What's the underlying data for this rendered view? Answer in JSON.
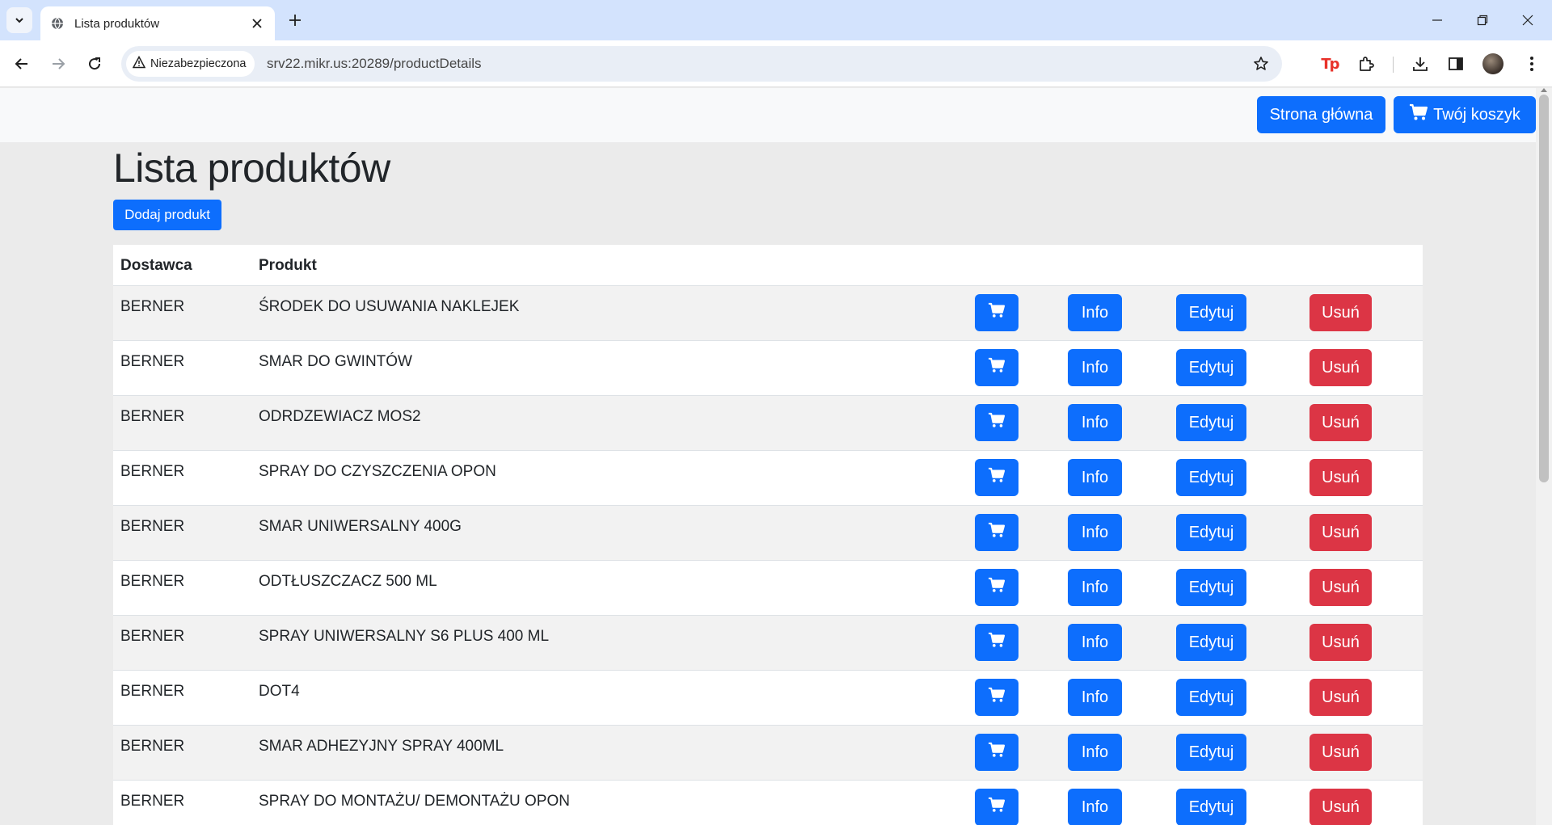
{
  "browser": {
    "tab_title": "Lista produktów",
    "security_label": "Niezabezpieczona",
    "url": "srv22.mikr.us:20289/productDetails"
  },
  "navbar": {
    "home_label": "Strona główna",
    "cart_label": "Twój koszyk"
  },
  "page": {
    "title": "Lista produktów",
    "add_button": "Dodaj produkt"
  },
  "table": {
    "headers": {
      "supplier": "Dostawca",
      "product": "Produkt"
    },
    "info_label": "Info",
    "edit_label": "Edytuj",
    "delete_label": "Usuń",
    "rows": [
      {
        "supplier": "BERNER",
        "product": "ŚRODEK DO USUWANIA NAKLEJEK"
      },
      {
        "supplier": "BERNER",
        "product": "SMAR DO GWINTÓW"
      },
      {
        "supplier": "BERNER",
        "product": "ODRDZEWIACZ MOS2"
      },
      {
        "supplier": "BERNER",
        "product": "SPRAY DO CZYSZCZENIA OPON"
      },
      {
        "supplier": "BERNER",
        "product": "SMAR UNIWERSALNY 400G"
      },
      {
        "supplier": "BERNER",
        "product": "ODTŁUSZCZACZ 500 ML"
      },
      {
        "supplier": "BERNER",
        "product": "SPRAY UNIWERSALNY S6 PLUS 400 ML"
      },
      {
        "supplier": "BERNER",
        "product": "DOT4"
      },
      {
        "supplier": "BERNER",
        "product": "SMAR ADHEZYJNY SPRAY 400ML"
      },
      {
        "supplier": "BERNER",
        "product": "SPRAY DO MONTAŻU/ DEMONTAŻU OPON"
      }
    ]
  },
  "colors": {
    "primary": "#0d6efd",
    "danger": "#dc3545",
    "page_background": "#ebebeb",
    "chrome_tabbar": "#d3e3fd"
  },
  "icons": [
    "tab-search-icon",
    "globe-icon",
    "close-icon",
    "plus-icon",
    "minimize-icon",
    "restore-icon",
    "back-icon",
    "forward-icon",
    "reload-icon",
    "warning-icon",
    "star-icon",
    "extension-icon",
    "download-icon",
    "sidebar-icon",
    "menu-icon",
    "cart-icon"
  ]
}
